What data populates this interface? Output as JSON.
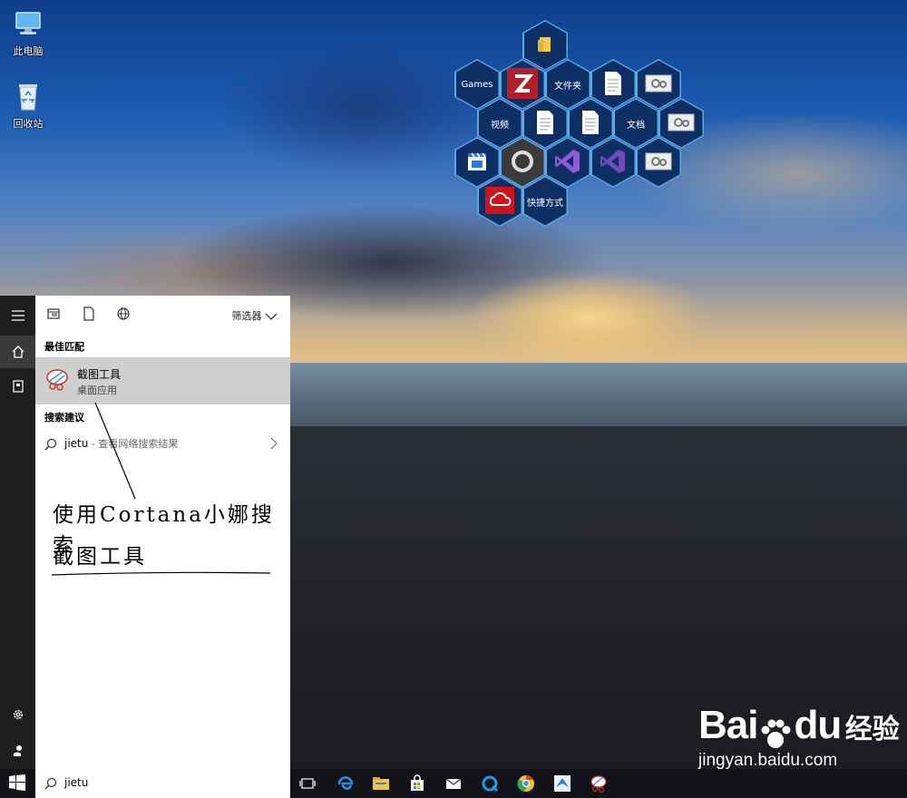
{
  "desktop": {
    "icons": [
      {
        "label": "此电脑",
        "icon": "this-pc-icon"
      },
      {
        "label": "回收站",
        "icon": "recycle-bin-icon"
      }
    ]
  },
  "launcher": {
    "tiles": [
      {
        "label": "",
        "icon": "folder-icon"
      },
      {
        "label": "Games",
        "icon": ""
      },
      {
        "label": "",
        "icon": "zotero-icon"
      },
      {
        "label": "文件夹",
        "icon": ""
      },
      {
        "label": "",
        "icon": "document-icon"
      },
      {
        "label": "",
        "icon": "settings-file-icon"
      },
      {
        "label": "视频",
        "icon": ""
      },
      {
        "label": "",
        "icon": "document-icon"
      },
      {
        "label": "",
        "icon": "document-icon"
      },
      {
        "label": "文档",
        "icon": ""
      },
      {
        "label": "",
        "icon": "settings-file-icon"
      },
      {
        "label": "",
        "icon": "clapperboard-icon"
      },
      {
        "label": "",
        "icon": "ring-icon"
      },
      {
        "label": "",
        "icon": "visual-studio-icon"
      },
      {
        "label": "",
        "icon": "visual-studio-icon"
      },
      {
        "label": "",
        "icon": "settings-file-icon"
      },
      {
        "label": "",
        "icon": "creative-cloud-icon"
      },
      {
        "label": "快捷方式",
        "icon": ""
      }
    ]
  },
  "start_menu": {
    "rail": [
      "hamburger-icon",
      "home-icon",
      "notebook-icon",
      "gear-icon",
      "user-icon"
    ],
    "toolbar": {
      "filter_label": "筛选器",
      "icons": [
        "apps-icon",
        "document-icon",
        "globe-icon"
      ]
    },
    "best_match": {
      "heading": "最佳匹配",
      "title": "截图工具",
      "subtitle": "桌面应用"
    },
    "suggestions": {
      "heading": "搜索建议",
      "query": "jietu",
      "description": " - 查看网络搜索结果"
    },
    "annotation": {
      "line1": "使用Cortana小娜搜索",
      "line2": "截图工具"
    }
  },
  "taskbar": {
    "search_value": "jietu",
    "apps": [
      "task-view-icon",
      "edge-icon",
      "file-explorer-icon",
      "store-icon",
      "mail-icon",
      "app-q-icon",
      "chrome-icon",
      "app-bird-icon",
      "snipping-tool-icon"
    ]
  },
  "watermark": {
    "brand": "Bai",
    "brand2": "du",
    "sub": "经验",
    "url": "jingyan.baidu.com"
  },
  "colors": {
    "hex_border": "#5aa9e6",
    "hex_fill": "#0d2f63",
    "rail_bg": "#1e1e1e",
    "best_match_bg": "#cfcfcf",
    "taskbar_bg": "#111318"
  }
}
